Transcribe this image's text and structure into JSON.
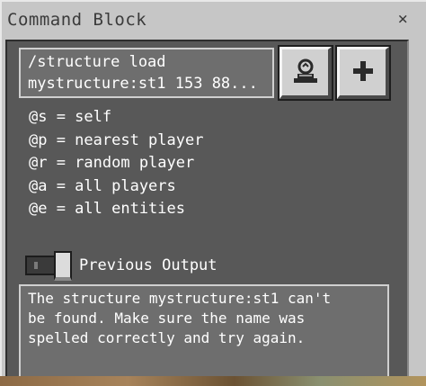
{
  "window": {
    "title": "Command Block",
    "close_glyph": "×"
  },
  "command": {
    "lines": [
      "/structure load",
      "mystructure:st1 153 88..."
    ]
  },
  "buttons": {
    "structure_icon": "structure-block-icon",
    "plus_icon": "plus-icon",
    "plus_glyph": "+"
  },
  "selectors": [
    "@s = self",
    "@p = nearest player",
    "@r = random player",
    "@a = all players",
    "@e = all entities"
  ],
  "previous_output": {
    "label": "Previous Output",
    "enabled": true
  },
  "output": {
    "lines": [
      "The structure mystructure:st1 can't",
      "be found. Make sure the name was",
      "spelled correctly and try again."
    ]
  },
  "colors": {
    "window_bg": "#c6c6c6",
    "panel_bg": "#585858",
    "field_bg": "#6e6e6e",
    "text": "#ffffff",
    "title_text": "#3b3b3b"
  }
}
